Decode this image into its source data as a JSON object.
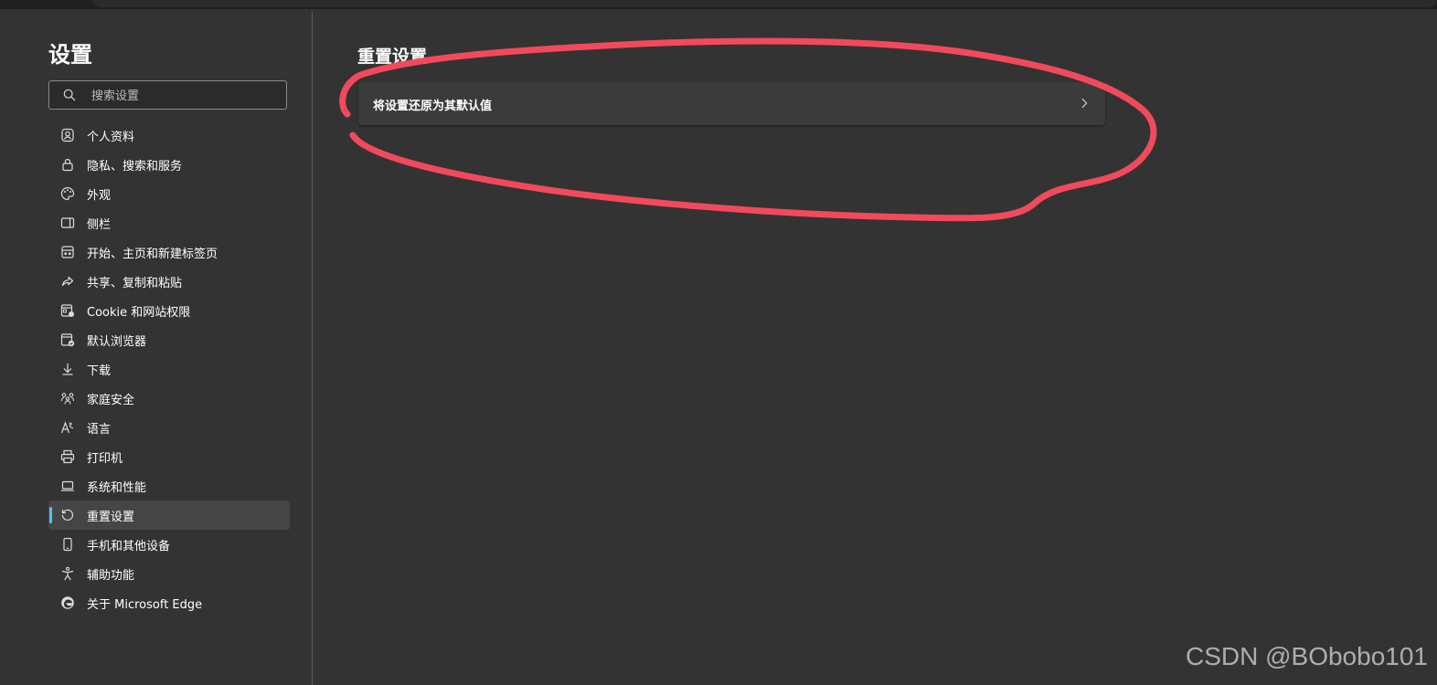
{
  "sidebar": {
    "title": "设置",
    "search": {
      "placeholder": "搜索设置",
      "value": ""
    },
    "items": [
      {
        "label": "个人资料",
        "icon": "profile-icon",
        "active": false
      },
      {
        "label": "隐私、搜索和服务",
        "icon": "lock-icon",
        "active": false
      },
      {
        "label": "外观",
        "icon": "palette-icon",
        "active": false
      },
      {
        "label": "侧栏",
        "icon": "sidebar-panel-icon",
        "active": false
      },
      {
        "label": "开始、主页和新建标签页",
        "icon": "home-grid-icon",
        "active": false
      },
      {
        "label": "共享、复制和粘贴",
        "icon": "share-icon",
        "active": false
      },
      {
        "label": "Cookie 和网站权限",
        "icon": "site-permissions-icon",
        "active": false
      },
      {
        "label": "默认浏览器",
        "icon": "default-browser-icon",
        "active": false
      },
      {
        "label": "下载",
        "icon": "download-icon",
        "active": false
      },
      {
        "label": "家庭安全",
        "icon": "family-icon",
        "active": false
      },
      {
        "label": "语言",
        "icon": "language-icon",
        "active": false
      },
      {
        "label": "打印机",
        "icon": "printer-icon",
        "active": false
      },
      {
        "label": "系统和性能",
        "icon": "laptop-icon",
        "active": false
      },
      {
        "label": "重置设置",
        "icon": "reset-icon",
        "active": true
      },
      {
        "label": "手机和其他设备",
        "icon": "phone-icon",
        "active": false
      },
      {
        "label": "辅助功能",
        "icon": "accessibility-icon",
        "active": false
      },
      {
        "label": "关于 Microsoft Edge",
        "icon": "edge-logo-icon",
        "active": false
      }
    ]
  },
  "main": {
    "title": "重置设置",
    "reset_option": {
      "label": "将设置还原为其默认值",
      "icon": "chevron-right-icon"
    }
  },
  "annotation": {
    "color": "#f24a5c"
  },
  "watermark": "CSDN @BObobo101",
  "colors": {
    "background": "#333333",
    "card": "#3b3b3b",
    "active_item": "#454545",
    "accent": "#4cc2ff"
  }
}
